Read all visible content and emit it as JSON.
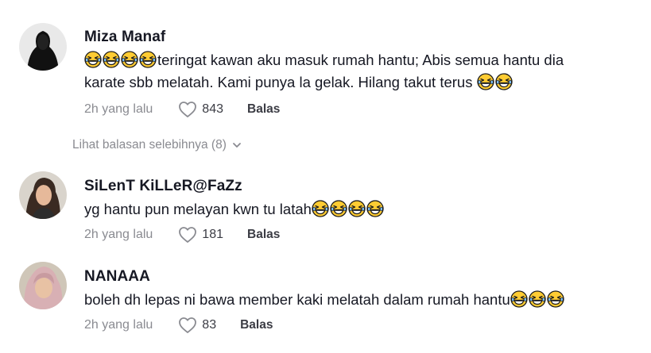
{
  "comments": [
    {
      "username": "Miza Manaf",
      "line1_prefix_emojis": 4,
      "line1": "teringat kawan aku masuk rumah hantu; Abis semua hantu dia",
      "line2": "karate sbb melatah. Kami punya la gelak. Hilang takut terus",
      "line2_suffix_emojis": 2,
      "time": "2h yang lalu",
      "likes": "843",
      "reply_label": "Balas"
    },
    {
      "username": "SiLenT KiLLeR@FaZz",
      "line1": "yg hantu pun melayan kwn tu latah",
      "line1_suffix_emojis": 4,
      "time": "2h yang lalu",
      "likes": "181",
      "reply_label": "Balas"
    },
    {
      "username": "NANAAA",
      "line1": "boleh dh lepas ni bawa member kaki melatah dalam rumah hantu",
      "line1_suffix_emojis": 3,
      "time": "2h yang lalu",
      "likes": "83",
      "reply_label": "Balas"
    }
  ],
  "view_replies_label": "Lihat balasan selebihnya (8)",
  "icons": {
    "emoji": "grinning-squinting-face-with-tears-icon",
    "like": "heart-outline-icon",
    "expand": "chevron-down-icon"
  },
  "colors": {
    "text": "#161823",
    "muted": "#8a8b91",
    "emoji_face": "#ffcc33"
  }
}
